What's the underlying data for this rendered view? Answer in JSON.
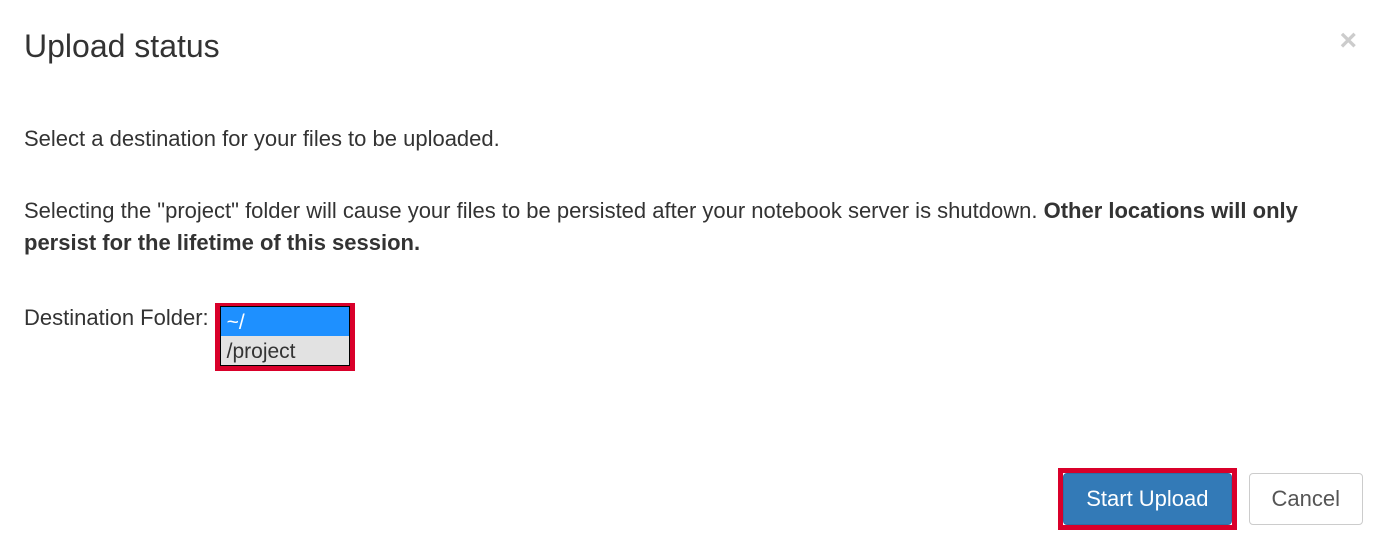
{
  "modal": {
    "title": "Upload status",
    "close_glyph": "×",
    "intro": "Select a destination for your files to be uploaded.",
    "persist_text_prefix": "Selecting the \"project\" folder will cause your files to be persisted after your notebook server is shutdown. ",
    "persist_text_bold": "Other locations will only persist for the lifetime of this session.",
    "dest_label": "Destination Folder:",
    "options": {
      "home": "~/",
      "project": "/project"
    },
    "buttons": {
      "start": "Start Upload",
      "cancel": "Cancel"
    }
  }
}
